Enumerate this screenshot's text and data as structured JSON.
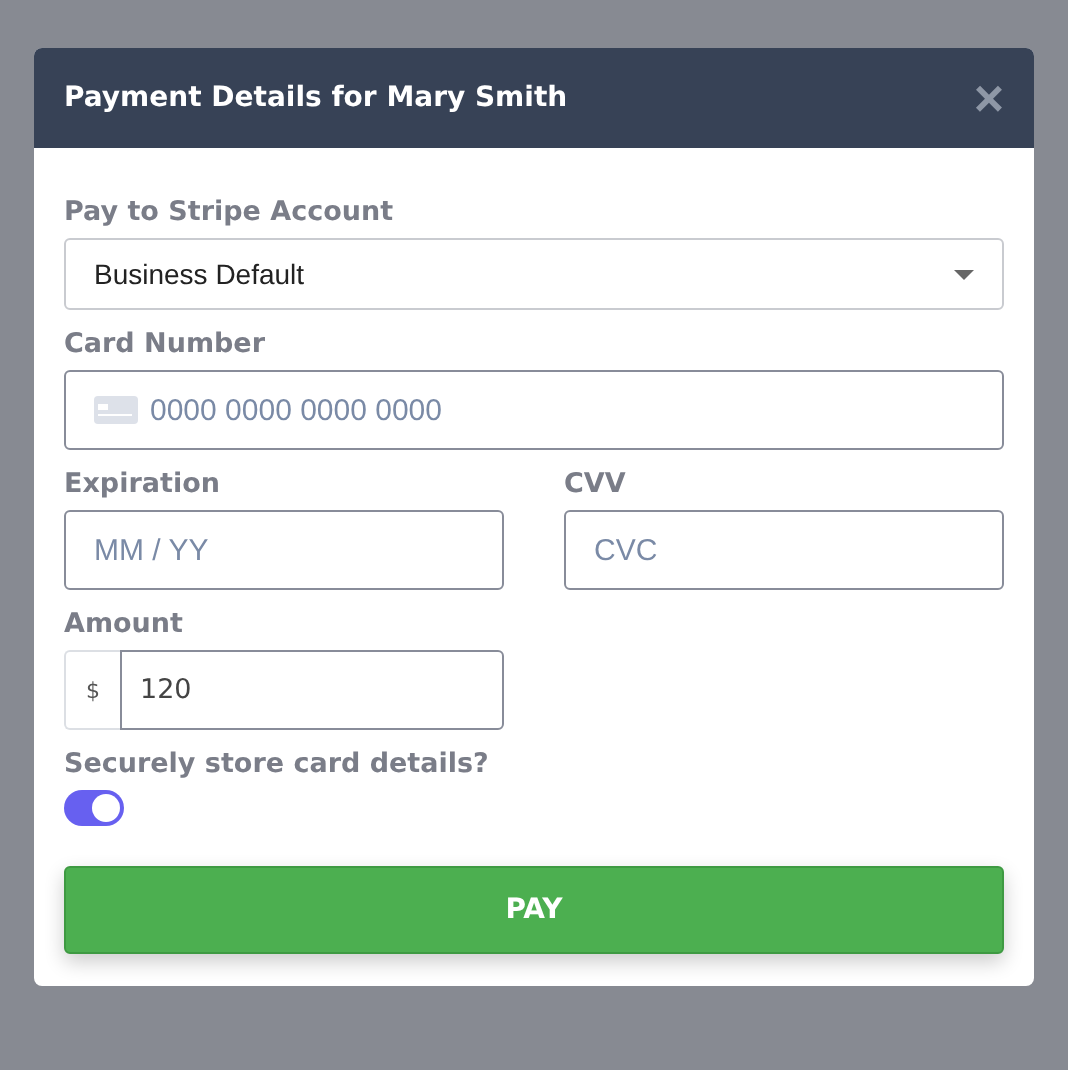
{
  "dialog": {
    "title": "Payment Details for Mary Smith",
    "close": "×"
  },
  "account": {
    "label": "Pay to Stripe Account",
    "value": "Business Default"
  },
  "card_number": {
    "label": "Card Number",
    "placeholder": "0000 0000 0000 0000"
  },
  "expiration": {
    "label": "Expiration",
    "placeholder": "MM / YY"
  },
  "cvv": {
    "label": "CVV",
    "placeholder": "CVC"
  },
  "amount": {
    "label": "Amount",
    "prefix": "$",
    "value": "120"
  },
  "store_card": {
    "label": "Securely store card details?",
    "on": true
  },
  "pay_button": "PAY"
}
